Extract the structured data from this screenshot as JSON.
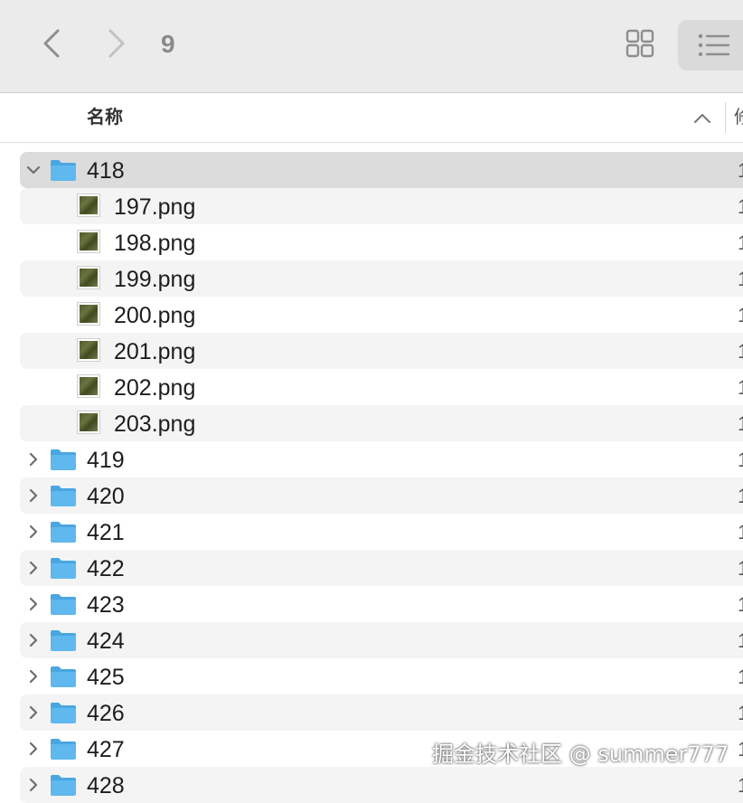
{
  "toolbar": {
    "back_icon": "chevron-left-icon",
    "forward_icon": "chevron-right-icon",
    "title": "9",
    "grid_view_icon": "grid-icon",
    "list_view_icon": "list-icon"
  },
  "columns": {
    "name_label": "名称",
    "sort_icon": "chevron-up-icon",
    "next_label": "修"
  },
  "rows": [
    {
      "kind": "folder",
      "name": "418",
      "expanded": true,
      "trailing": "1"
    },
    {
      "kind": "file",
      "name": "197.png",
      "trailing": "1"
    },
    {
      "kind": "file",
      "name": "198.png",
      "trailing": "1"
    },
    {
      "kind": "file",
      "name": "199.png",
      "trailing": "1"
    },
    {
      "kind": "file",
      "name": "200.png",
      "trailing": "1"
    },
    {
      "kind": "file",
      "name": "201.png",
      "trailing": "1"
    },
    {
      "kind": "file",
      "name": "202.png",
      "trailing": "1"
    },
    {
      "kind": "file",
      "name": "203.png",
      "trailing": "1"
    },
    {
      "kind": "folder",
      "name": "419",
      "expanded": false,
      "trailing": "1"
    },
    {
      "kind": "folder",
      "name": "420",
      "expanded": false,
      "trailing": "1"
    },
    {
      "kind": "folder",
      "name": "421",
      "expanded": false,
      "trailing": "1"
    },
    {
      "kind": "folder",
      "name": "422",
      "expanded": false,
      "trailing": "1"
    },
    {
      "kind": "folder",
      "name": "423",
      "expanded": false,
      "trailing": "1"
    },
    {
      "kind": "folder",
      "name": "424",
      "expanded": false,
      "trailing": "1"
    },
    {
      "kind": "folder",
      "name": "425",
      "expanded": false,
      "trailing": "1"
    },
    {
      "kind": "folder",
      "name": "426",
      "expanded": false,
      "trailing": "1"
    },
    {
      "kind": "folder",
      "name": "427",
      "expanded": false,
      "trailing": "1"
    },
    {
      "kind": "folder",
      "name": "428",
      "expanded": false,
      "trailing": "1"
    }
  ],
  "watermark": "掘金技术社区 @ summer777",
  "colors": {
    "folder": "#5fb8ee",
    "selected_row": "#dcdcdc",
    "alt_row": "#f4f4f4",
    "toolbar_bg": "#ebebeb"
  }
}
